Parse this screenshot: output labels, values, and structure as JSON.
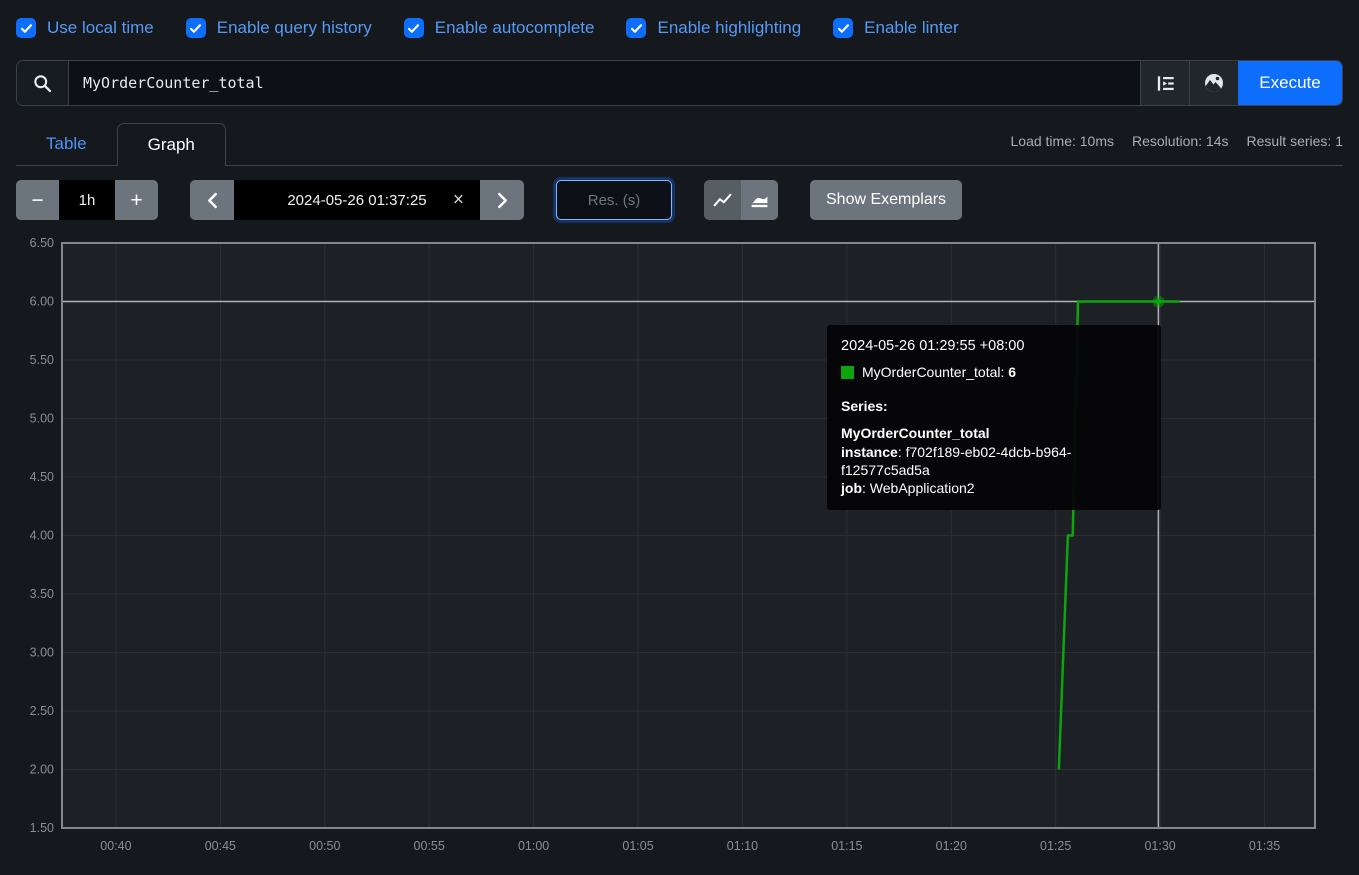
{
  "options": {
    "items": [
      {
        "label": "Use local time",
        "checked": true
      },
      {
        "label": "Enable query history",
        "checked": true
      },
      {
        "label": "Enable autocomplete",
        "checked": true
      },
      {
        "label": "Enable highlighting",
        "checked": true
      },
      {
        "label": "Enable linter",
        "checked": true
      }
    ]
  },
  "query": {
    "value": "MyOrderCounter_total",
    "execute_label": "Execute"
  },
  "tabs": {
    "table": "Table",
    "graph": "Graph"
  },
  "stats": {
    "load_time": "Load time: 10ms",
    "resolution": "Resolution: 14s",
    "result_series": "Result series: 1"
  },
  "controls": {
    "minus": "−",
    "duration": "1h",
    "plus": "+",
    "datetime": "2024-05-26 01:37:25",
    "clear": "×",
    "res_placeholder": "Res. (s)",
    "show_exemplars": "Show Exemplars"
  },
  "tooltip": {
    "timestamp": "2024-05-26 01:29:55 +08:00",
    "series_name": "MyOrderCounter_total",
    "value": "6",
    "series_heading": "Series:",
    "series_title": "MyOrderCounter_total",
    "labels": [
      {
        "key": "instance",
        "value": "f702f189-eb02-4dcb-b964-f12577c5ad5a"
      },
      {
        "key": "job",
        "value": "WebApplication2"
      }
    ]
  },
  "chart_data": {
    "type": "line",
    "title": "",
    "xlabel": "",
    "ylabel": "",
    "x_range": [
      "00:37:25",
      "01:37:25"
    ],
    "ylim": [
      1.5,
      6.5
    ],
    "grid": true,
    "x_ticks": [
      {
        "label": "00:40",
        "time": "00:40"
      },
      {
        "label": "00:45",
        "time": "00:45"
      },
      {
        "label": "00:50",
        "time": "00:50"
      },
      {
        "label": "00:55",
        "time": "00:55"
      },
      {
        "label": "01:00",
        "time": "01:00"
      },
      {
        "label": "01:05",
        "time": "01:05"
      },
      {
        "label": "01:10",
        "time": "01:10"
      },
      {
        "label": "01:15",
        "time": "01:15"
      },
      {
        "label": "01:20",
        "time": "01:20"
      },
      {
        "label": "01:25",
        "time": "01:25"
      },
      {
        "label": "01:30",
        "time": "01:30"
      },
      {
        "label": "01:35",
        "time": "01:35"
      }
    ],
    "y_ticks": [
      {
        "label": "1.50",
        "value": 1.5
      },
      {
        "label": "2.00",
        "value": 2.0
      },
      {
        "label": "2.50",
        "value": 2.5
      },
      {
        "label": "3.00",
        "value": 3.0
      },
      {
        "label": "3.50",
        "value": 3.5
      },
      {
        "label": "4.00",
        "value": 4.0
      },
      {
        "label": "4.50",
        "value": 4.5
      },
      {
        "label": "5.00",
        "value": 5.0
      },
      {
        "label": "5.50",
        "value": 5.5
      },
      {
        "label": "6.00",
        "value": 6.0
      },
      {
        "label": "6.50",
        "value": 6.5
      }
    ],
    "series": [
      {
        "name": "MyOrderCounter_total",
        "labels": {
          "instance": "f702f189-eb02-4dcb-b964-f12577c5ad5a",
          "job": "WebApplication2"
        },
        "color": "#0ca60c",
        "points": [
          [
            "01:25:09",
            2
          ],
          [
            "01:25:35",
            4
          ],
          [
            "01:25:49",
            4
          ],
          [
            "01:26:04",
            6
          ],
          [
            "01:30:57",
            6
          ]
        ]
      }
    ],
    "hover_point": {
      "time": "01:29:55",
      "value": 6,
      "series": "MyOrderCounter_total"
    },
    "colors": {
      "plot_bg": "#1d2125",
      "grid": "#2b2f34",
      "frame": "#83888e",
      "crosshair": "#aeb2b6",
      "tick_label": "#8a8f95"
    }
  }
}
